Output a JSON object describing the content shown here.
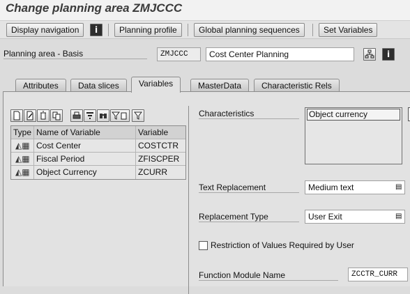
{
  "window": {
    "title": "Change planning area ZMJCCC"
  },
  "toolbar": {
    "display_navigation": "Display navigation",
    "info_icon": "i",
    "planning_profile": "Planning profile",
    "global_planning_sequences": "Global planning sequences",
    "set_variables": "Set Variables"
  },
  "header": {
    "label": "Planning area - Basis",
    "area_id": "ZMJCCC",
    "area_desc": "Cost Center Planning",
    "hierarchy_icon": "hierarchy-icon",
    "info_icon": "i"
  },
  "tabs": [
    {
      "label": "Attributes",
      "active": false
    },
    {
      "label": "Data slices",
      "active": false
    },
    {
      "label": "Variables",
      "active": true
    },
    {
      "label": "MasterData",
      "active": false
    },
    {
      "label": "Characteristic Rels",
      "active": false
    }
  ],
  "grid_toolbar": {
    "icons": [
      "create-icon",
      "edit-icon",
      "delete-icon",
      "copy-icon",
      "print-icon",
      "sort-icon",
      "find-icon",
      "filter-set-icon",
      "filter-icon"
    ]
  },
  "grid": {
    "columns": [
      "Type",
      "Name of Variable",
      "Variable"
    ],
    "rows": [
      {
        "type_icon": "variable-type-icon",
        "name": "Cost Center",
        "variable": "COSTCTR"
      },
      {
        "type_icon": "variable-type-icon",
        "name": "Fiscal Period",
        "variable": "ZFISCPER"
      },
      {
        "type_icon": "variable-type-icon",
        "name": "Object Currency",
        "variable": "ZCURR"
      }
    ]
  },
  "details": {
    "characteristics_label": "Characteristics",
    "characteristics_value": "Object currency",
    "text_replacement_label": "Text Replacement",
    "text_replacement_value": "Medium text",
    "replacement_type_label": "Replacement Type",
    "replacement_type_value": "User Exit",
    "restriction_label": "Restriction of Values Required by User",
    "restriction_checked": false,
    "function_module_label": "Function Module Name",
    "function_module_value": "ZCCTR_CURR"
  },
  "colors": {
    "background": "#dcdcdc",
    "title": "#3a3a3a",
    "field": "#ececec",
    "input": "#ffffff"
  }
}
